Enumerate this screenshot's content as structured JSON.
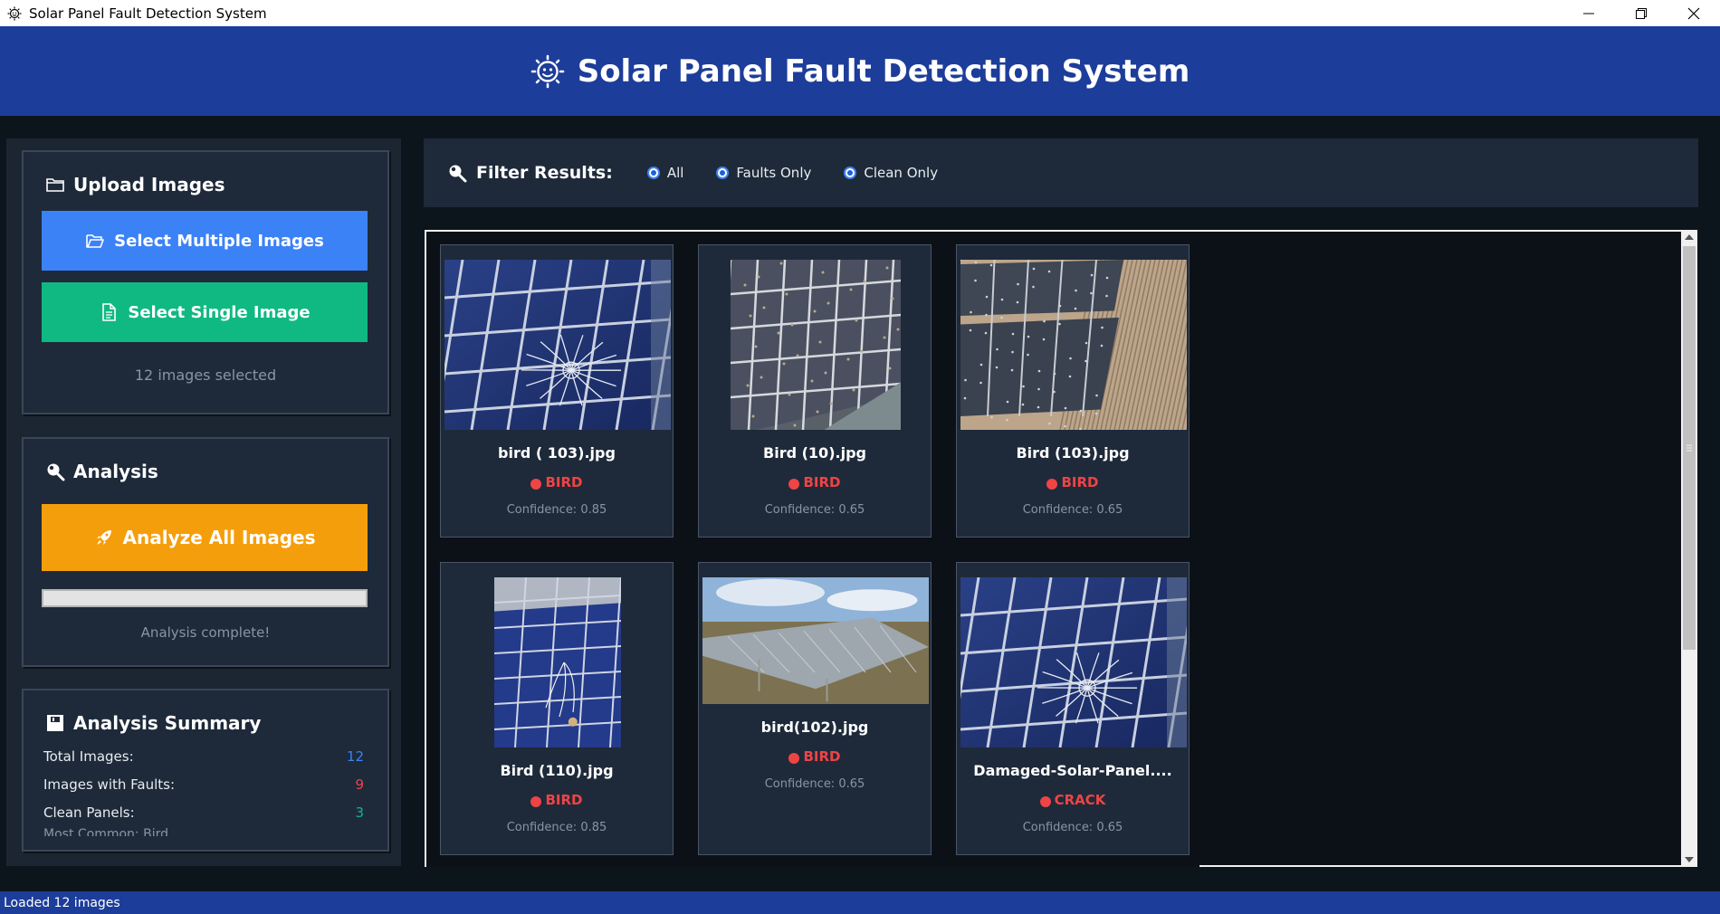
{
  "window": {
    "title": "Solar Panel Fault Detection System"
  },
  "header": {
    "title": "Solar Panel Fault Detection System"
  },
  "upload": {
    "title": "Upload Images",
    "multi_button": "Select Multiple Images",
    "single_button": "Select Single Image",
    "selected_text": "12 images selected"
  },
  "analysis": {
    "title": "Analysis",
    "analyze_button": "Analyze All Images",
    "progress": 1.0,
    "status": "Analysis complete!"
  },
  "summary": {
    "title": "Analysis Summary",
    "rows": [
      {
        "label": "Total Images:",
        "value": "12"
      },
      {
        "label": "Images with Faults:",
        "value": "9"
      },
      {
        "label": "Clean Panels:",
        "value": "3"
      }
    ],
    "clipped_text": "Most Common: Bird"
  },
  "filter": {
    "label": "Filter Results:",
    "options": [
      "All",
      "Faults Only",
      "Clean Only"
    ]
  },
  "cards": [
    {
      "name": "bird ( 103).jpg",
      "fault": "BIRD",
      "confidence": "Confidence: 0.85",
      "scene": "crack-near"
    },
    {
      "name": "Bird (10).jpg",
      "fault": "BIRD",
      "confidence": "Confidence: 0.65",
      "scene": "panel-dirty"
    },
    {
      "name": "Bird (103).jpg",
      "fault": "BIRD",
      "confidence": "Confidence: 0.65",
      "scene": "roof-rows"
    },
    {
      "name": "Bird (110).jpg",
      "fault": "BIRD",
      "confidence": "Confidence: 0.85",
      "scene": "panel-tall"
    },
    {
      "name": "bird(102).jpg",
      "fault": "BIRD",
      "confidence": "Confidence: 0.65",
      "scene": "field-array"
    },
    {
      "name": "Damaged-Solar-Panel....",
      "fault": "CRACK",
      "confidence": "Confidence: 0.65",
      "scene": "crack-near"
    }
  ],
  "statusbar": {
    "text": "Loaded 12 images"
  },
  "colors": {
    "header_bg": "#1d3d9a",
    "fault_red": "#ef4444",
    "blue": "#3b82f6",
    "green": "#10b981",
    "orange": "#f59e0b"
  }
}
